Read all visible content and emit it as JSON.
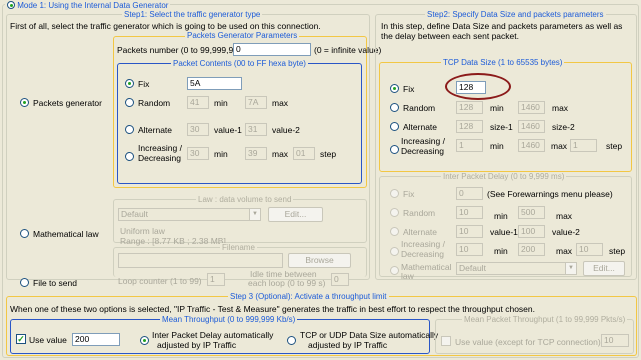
{
  "mode": {
    "title": "Mode 1: Using the Internal Data Generator"
  },
  "step1": {
    "title": "Step1: Select the traffic generator type",
    "intro": "First of all, select the traffic generator which is going to be used on this connection.",
    "packets_generator": {
      "label": "Packets generator",
      "params_title": "Packets Generator Parameters",
      "packets_number_label": "Packets number (0 to 99,999,999)",
      "packets_number_value": "0",
      "infinite_note": "(0 = infinite value)",
      "contents_title": "Packet Contents (00 to FF hexa byte)",
      "fix_label": "Fix",
      "fix_value": "5A",
      "random_label": "Random",
      "random_min": "41",
      "random_max": "7A",
      "min_label": "min",
      "max_label": "max",
      "alternate_label": "Alternate",
      "alt_v1": "30",
      "alt_v1_label": "value-1",
      "alt_v2": "31",
      "alt_v2_label": "value-2",
      "incdec_label_1": "Increasing /",
      "incdec_label_2": "Decreasing",
      "incdec_min": "30",
      "incdec_max": "39",
      "incdec_step": "01",
      "step_label": "step"
    },
    "math_law": {
      "label": "Mathematical law",
      "title": "Law : data volume to send",
      "select_value": "Default",
      "edit_label": "Edit...",
      "desc_1": "Uniform law",
      "desc_2": "Range : [8.77 KB ; 2.38 MB]"
    },
    "file_send": {
      "label": "File to send",
      "title": "Filename",
      "browse_label": "Browse",
      "loop_label": "Loop counter (1 to 99)",
      "loop_value": "1",
      "idle_label_1": "Idle time between",
      "idle_label_2": "each loop (0 to 99 s)",
      "idle_value": "0"
    }
  },
  "step2": {
    "title": "Step2: Specify Data Size and packets parameters",
    "intro_1": "In this step, define Data Size and packets parameters as well as",
    "intro_2": "the delay between each sent packet.",
    "tcp": {
      "title": "TCP Data Size (1 to 65535 bytes)",
      "fix_label": "Fix",
      "fix_value": "128",
      "random_label": "Random",
      "random_min": "128",
      "random_max": "1460",
      "min_label": "min",
      "max_label": "max",
      "alternate_label": "Alternate",
      "alt_v1": "128",
      "alt_v1_label": "size-1",
      "alt_v2": "1460",
      "alt_v2_label": "size-2",
      "incdec_label_1": "Increasing /",
      "incdec_label_2": "Decreasing",
      "incdec_min": "1",
      "incdec_max": "1460",
      "incdec_step": "1",
      "step_label": "step"
    },
    "ipd": {
      "title": "Inter Packet Delay (0 to 9,999 ms)",
      "fix_label": "Fix",
      "fix_value": "0",
      "fix_note": "(See Forewarnings menu please)",
      "random_label": "Random",
      "random_min": "10",
      "random_max": "500",
      "min_label": "min",
      "max_label": "max",
      "alternate_label": "Alternate",
      "alt_v1": "10",
      "alt_v1_label": "value-1",
      "alt_v2": "100",
      "alt_v2_label": "value-2",
      "incdec_label_1": "Increasing /",
      "incdec_label_2": "Decreasing",
      "incdec_min": "10",
      "incdec_max": "200",
      "incdec_step": "10",
      "step_label": "step",
      "math_label_1": "Mathematical",
      "math_label_2": "law",
      "math_select": "Default",
      "edit_label": "Edit..."
    }
  },
  "step3": {
    "title": "Step 3 (Optional): Activate a throughput limit",
    "intro": "When one of these two options is selected, \"IP Traffic - Test & Measure\" generates the traffic in best effort to respect the throughput chosen.",
    "mean_title": "Mean Throughput (0 to 999,999 Kb/s)",
    "use_value_label": "Use value",
    "use_value": "200",
    "ipd_auto_1": "Inter Packet Delay automatically",
    "ipd_auto_2": "adjusted by IP Traffic",
    "tcp_auto_1": "TCP or UDP Data Size automatically",
    "tcp_auto_2": "adjusted by IP Traffic",
    "mean_pkt_title": "Mean Packet Throughput (1 to 99,999 Pkts/s)",
    "use_value_except": "Use value (except for TCP connection)",
    "pkt_value": "10"
  },
  "colors": {
    "accent": "#1c5bd8",
    "annotation": "#8b1a1a",
    "group_gold": "#f2c744",
    "group_blue": "#2a56c6"
  }
}
